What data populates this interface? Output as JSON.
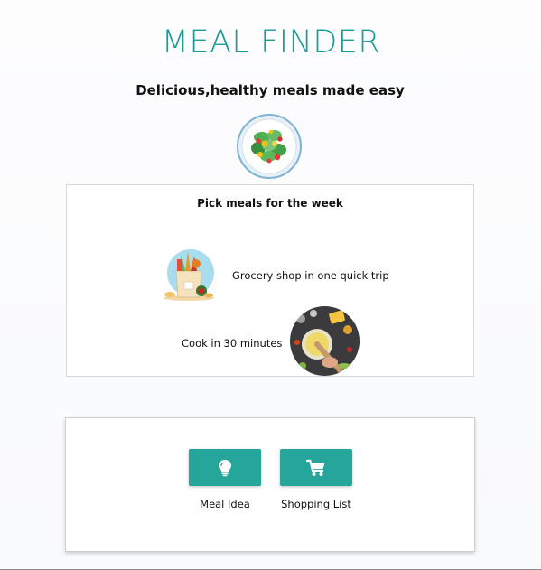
{
  "header": {
    "title": "MEAL FINDER",
    "subtitle": "Delicious,healthy meals made easy"
  },
  "plan_card": {
    "title": "Pick meals for the week",
    "grocery_text": "Grocery shop in one quick trip",
    "cook_text": "Cook in 30 minutes"
  },
  "actions": {
    "meal_idea_label": "Meal Idea",
    "meal_idea_icon": "lightbulb-icon",
    "shopping_list_label": "Shopping List",
    "shopping_list_icon": "cart-icon"
  },
  "colors": {
    "accent": "#26a69a",
    "title": "#199b96"
  }
}
